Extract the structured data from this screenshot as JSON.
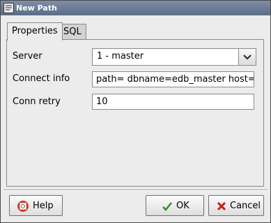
{
  "window": {
    "title": "New Path"
  },
  "tabs": [
    {
      "label": "Properties"
    },
    {
      "label": "SQL"
    }
  ],
  "form": {
    "server_label": "Server",
    "server_value": "1 - master",
    "connect_label": "Connect info",
    "connect_value": "path= dbname=edb_master host=localh",
    "retry_label": "Conn retry",
    "retry_value": "10"
  },
  "buttons": {
    "help": "Help",
    "ok": "OK",
    "cancel": "Cancel"
  },
  "icons": {
    "title": "window-app-icon",
    "combo": "chevron-down-icon",
    "help": "lifebuoy-icon",
    "ok": "checkmark-icon",
    "cancel": "x-icon"
  },
  "colors": {
    "titlebar": "#6b7a95",
    "ok_check": "#2a8f2a",
    "cancel_x": "#cc1b1b",
    "help_ring": "#cf3a24"
  }
}
